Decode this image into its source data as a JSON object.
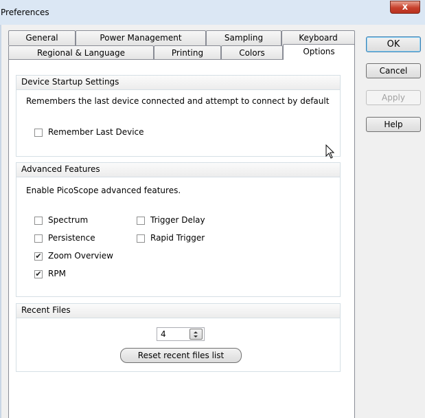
{
  "window": {
    "title": "Preferences",
    "close_glyph": "x"
  },
  "tabs": {
    "row1": [
      "General",
      "Power Management",
      "Sampling",
      "Keyboard"
    ],
    "row2": [
      "Regional & Language",
      "Printing",
      "Colors",
      "Options"
    ],
    "active": "Options"
  },
  "buttons": {
    "ok": "OK",
    "cancel": "Cancel",
    "apply": "Apply",
    "help": "Help"
  },
  "device_startup": {
    "heading": "Device Startup Settings",
    "description": "Remembers the last device connected and attempt to connect by default",
    "remember_label": "Remember Last Device",
    "remember_checked": false
  },
  "advanced": {
    "heading": "Advanced Features",
    "description": "Enable PicoScope advanced features.",
    "options": [
      {
        "label": "Spectrum",
        "checked": false
      },
      {
        "label": "Persistence",
        "checked": false
      },
      {
        "label": "Zoom Overview",
        "checked": true
      },
      {
        "label": "RPM",
        "checked": true
      },
      {
        "label": "Trigger Delay",
        "checked": false
      },
      {
        "label": "Rapid Trigger",
        "checked": false
      }
    ]
  },
  "recent_files": {
    "heading": "Recent Files",
    "count": "4",
    "reset_label": "Reset recent files list"
  },
  "icons": {
    "close": "close-icon",
    "cursor": "mouse-pointer-icon",
    "spin_up": "arrow-up-icon",
    "spin_down": "arrow-down-icon"
  }
}
